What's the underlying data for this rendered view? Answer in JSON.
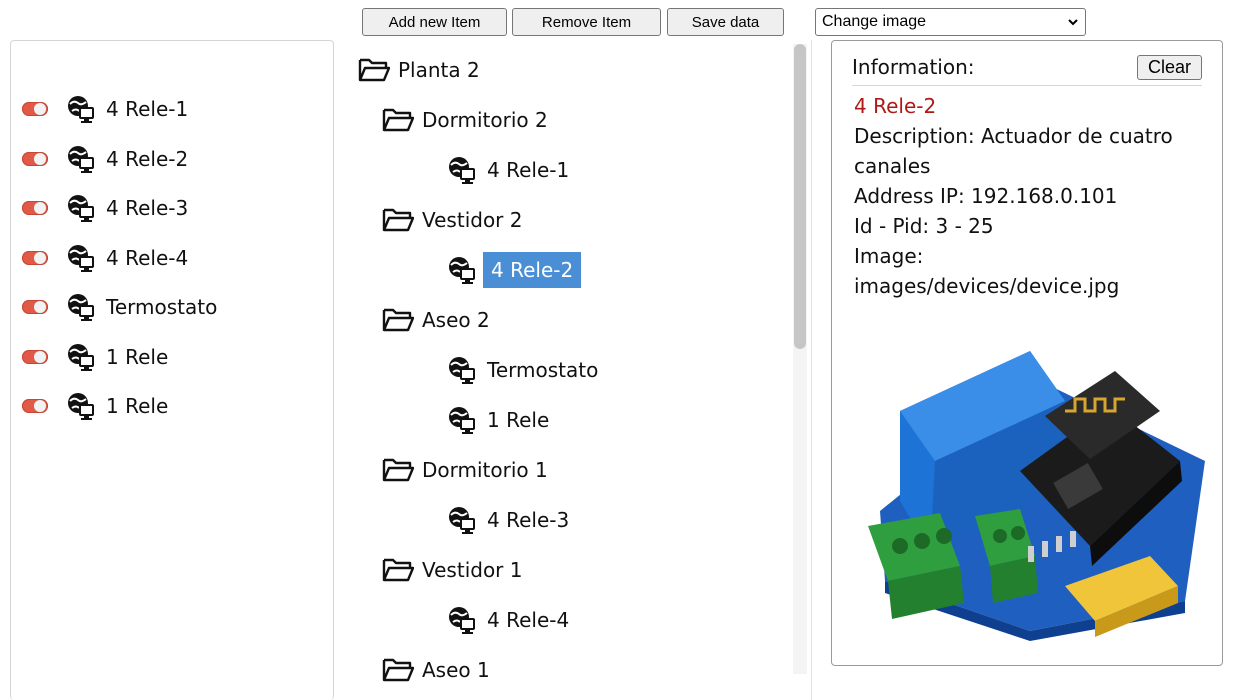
{
  "toolbar": {
    "add_label": "Add new Item",
    "remove_label": "Remove Item",
    "save_label": "Save data",
    "image_select_value": "Change image"
  },
  "devices": [
    {
      "label": "4 Rele-1",
      "state": "on"
    },
    {
      "label": "4 Rele-2",
      "state": "on"
    },
    {
      "label": "4 Rele-3",
      "state": "on"
    },
    {
      "label": "4 Rele-4",
      "state": "on"
    },
    {
      "label": "Termostato",
      "state": "on"
    },
    {
      "label": "1 Rele",
      "state": "on"
    },
    {
      "label": "1 Rele",
      "state": "on"
    }
  ],
  "tree": [
    {
      "label": "Planta 2",
      "type": "folder",
      "level": 0
    },
    {
      "label": "Dormitorio 2",
      "type": "folder",
      "level": 1
    },
    {
      "label": "4 Rele-1",
      "type": "device",
      "level": 2
    },
    {
      "label": "Vestidor 2",
      "type": "folder",
      "level": 1
    },
    {
      "label": "4 Rele-2",
      "type": "device",
      "level": 2,
      "selected": true
    },
    {
      "label": "Aseo 2",
      "type": "folder",
      "level": 1
    },
    {
      "label": "Termostato",
      "type": "device",
      "level": 2
    },
    {
      "label": "1 Rele",
      "type": "device",
      "level": 2
    },
    {
      "label": "Dormitorio 1",
      "type": "folder",
      "level": 1
    },
    {
      "label": "4 Rele-3",
      "type": "device",
      "level": 2
    },
    {
      "label": "Vestidor 1",
      "type": "folder",
      "level": 1
    },
    {
      "label": "4 Rele-4",
      "type": "device",
      "level": 2
    },
    {
      "label": "Aseo 1",
      "type": "folder",
      "level": 1
    }
  ],
  "info": {
    "title": "Information:",
    "clear_label": "Clear",
    "name": "4 Rele-2",
    "description": "Description: Actuador de cuatro canales",
    "address": "Address IP: 192.168.0.101",
    "id_pid": "Id - Pid: 3 - 25",
    "image_label": "Image:",
    "image_path": "images/devices/device.jpg"
  },
  "icons": {
    "device": "network-device-icon",
    "folder": "folder-open-icon",
    "toggle": "toggle-switch-icon",
    "select": "chevron-down-icon"
  },
  "colors": {
    "toggle_on": "#e05a47",
    "selection": "#4a8fd6",
    "info_name": "#b01818"
  }
}
